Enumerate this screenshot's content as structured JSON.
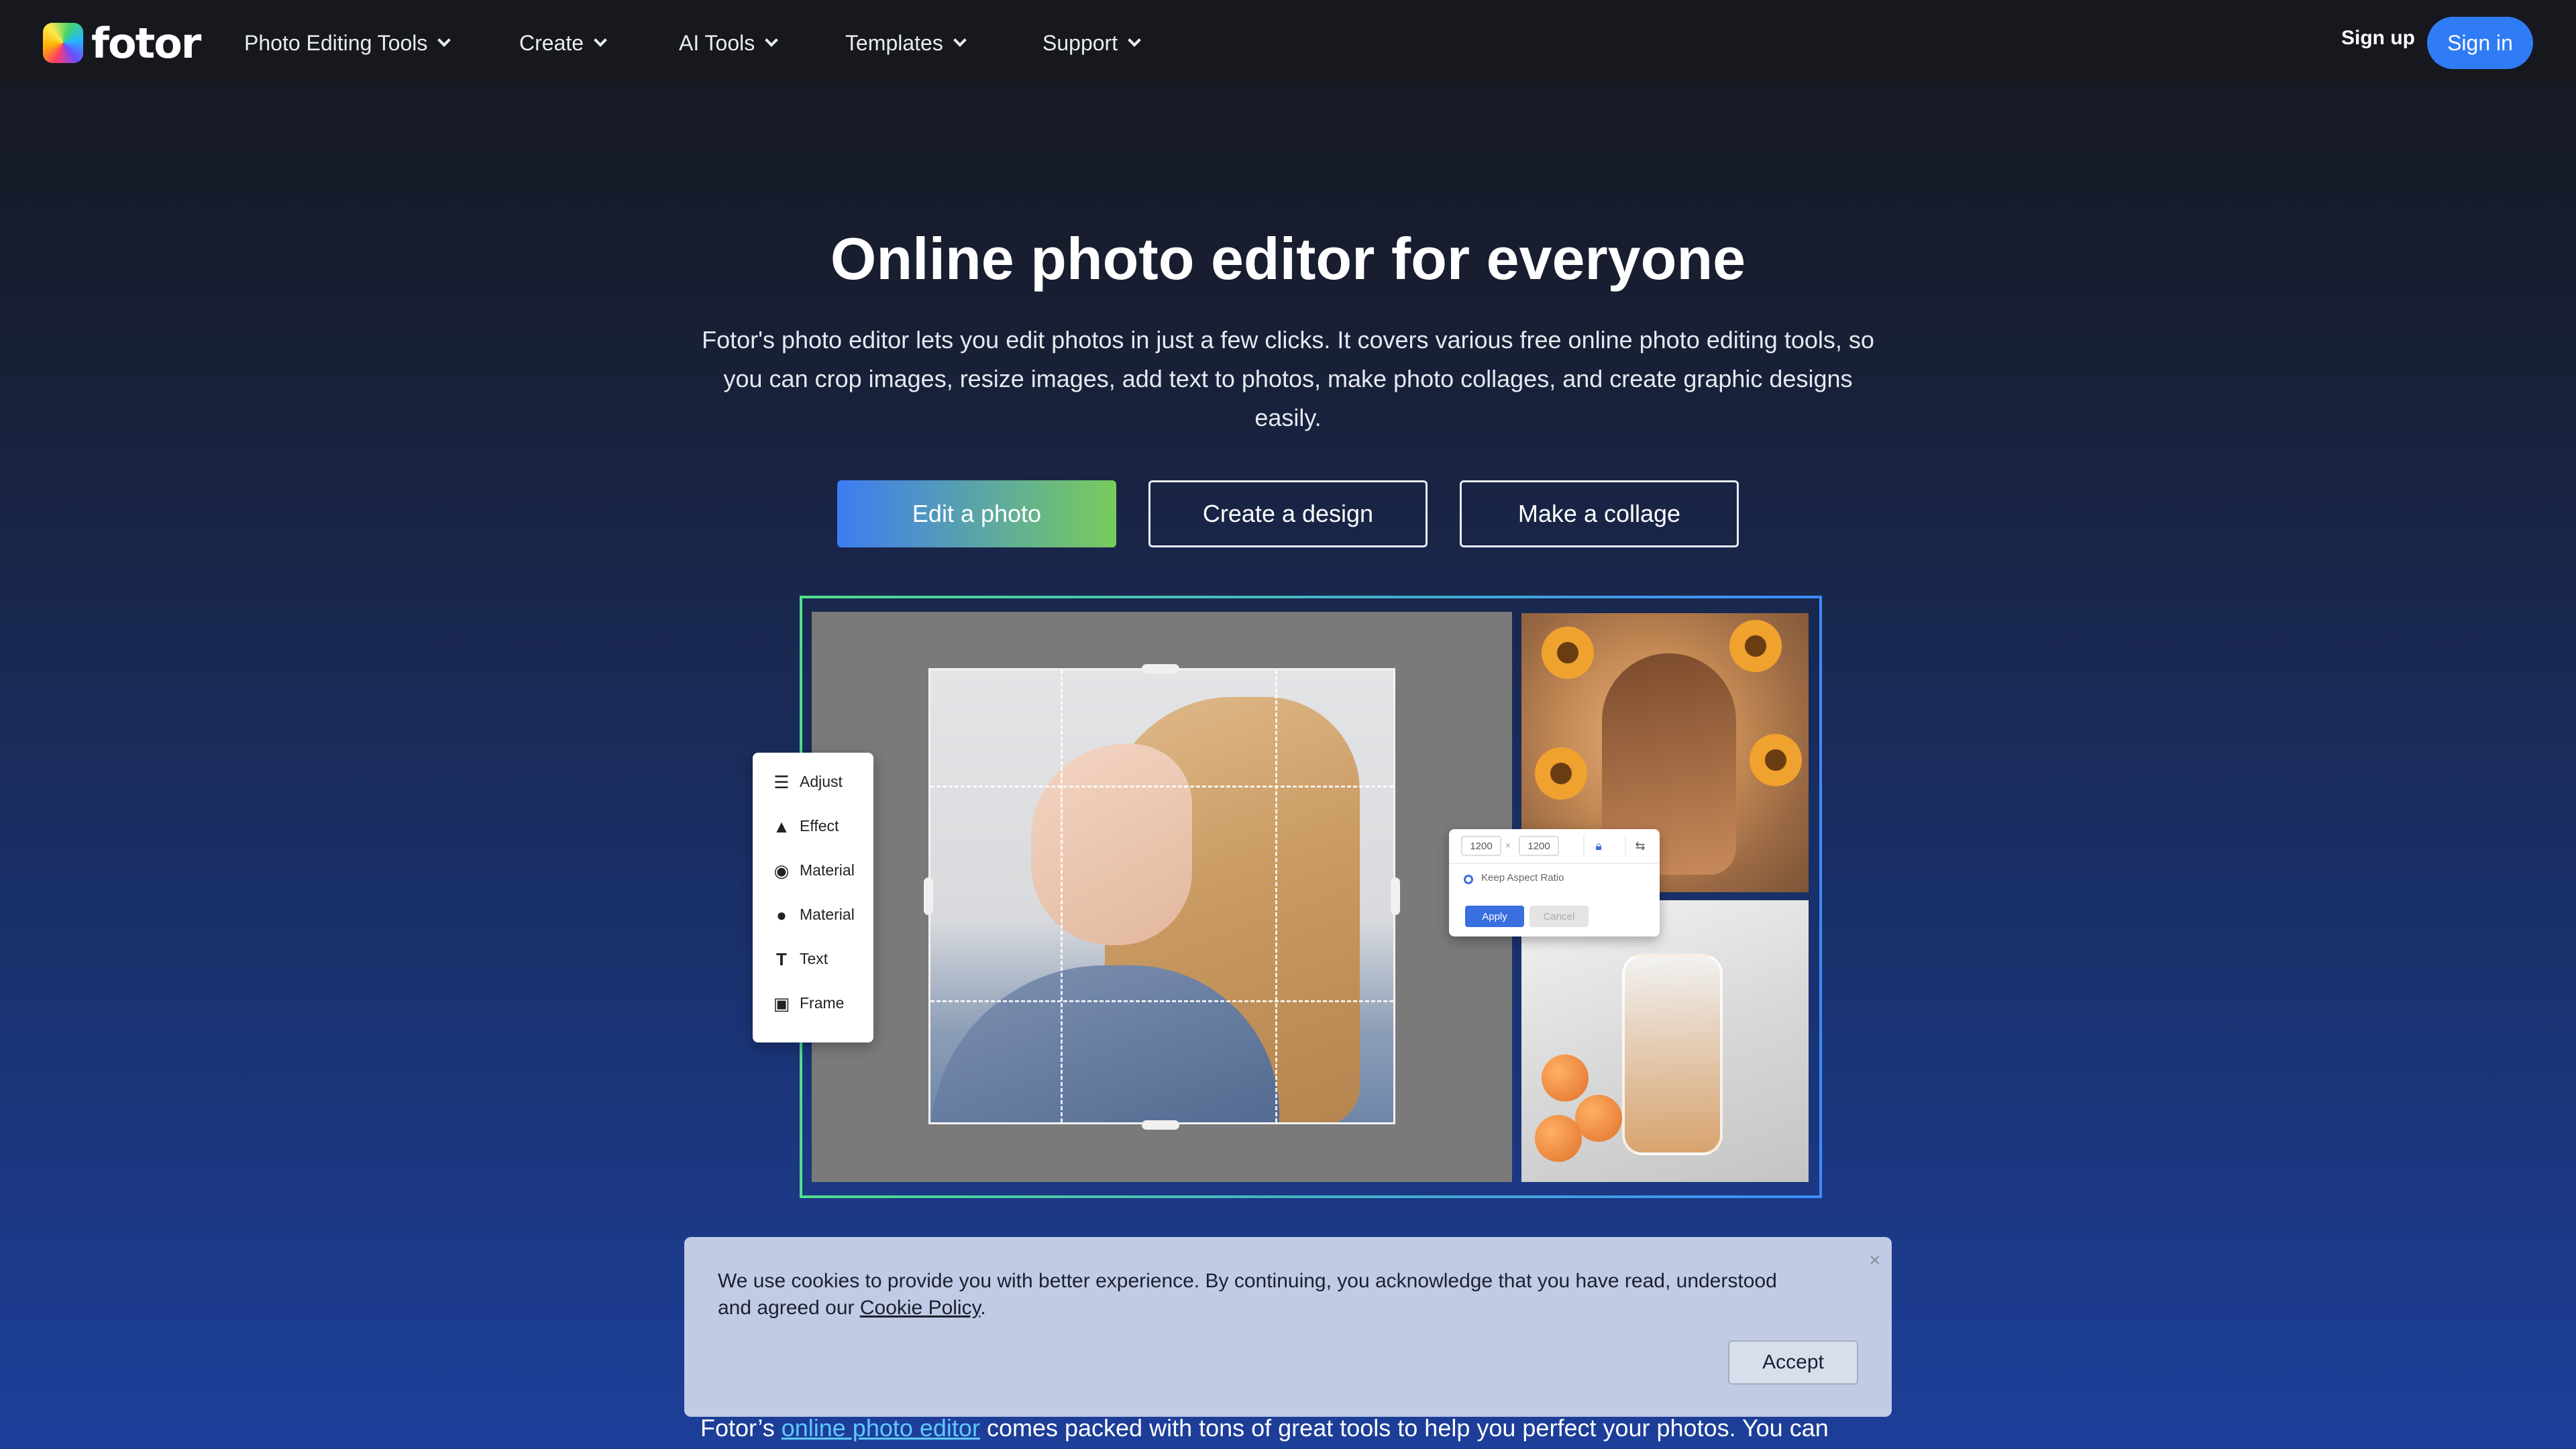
{
  "nav": {
    "logo_text": "fotor",
    "items": [
      {
        "label": "Photo Editing Tools"
      },
      {
        "label": "Create"
      },
      {
        "label": "AI Tools"
      },
      {
        "label": "Templates"
      },
      {
        "label": "Support"
      }
    ],
    "signup_label": "Sign up",
    "signin_label": "Sign in"
  },
  "hero": {
    "title": "Online photo editor for everyone",
    "description": "Fotor's photo editor lets you edit photos in just a few clicks. It covers various free online photo editing tools, so you can crop images, resize images, add text to photos, make photo collages, and create graphic designs easily.",
    "buttons": {
      "edit_photo": "Edit a photo",
      "create_design": "Create a design",
      "make_collage": "Make a collage"
    }
  },
  "showcase": {
    "tools": [
      {
        "label": "Adjust",
        "icon": "sliders-icon"
      },
      {
        "label": "Effect",
        "icon": "flask-icon"
      },
      {
        "label": "Material",
        "icon": "eye-icon"
      },
      {
        "label": "Material",
        "icon": "circle-icon"
      },
      {
        "label": "Text",
        "icon": "text-icon"
      },
      {
        "label": "Frame",
        "icon": "frame-icon"
      }
    ],
    "resize": {
      "width": "1200",
      "separator": "×",
      "height": "1200",
      "keep_aspect": "Keep Aspect Ratio",
      "apply": "Apply",
      "cancel": "Cancel"
    }
  },
  "section": {
    "text_before_link": "Fotor’s ",
    "link_text": "online photo editor",
    "text_after_link": " comes packed with tons of great tools to help you perfect your photos. You can"
  },
  "cookie": {
    "text": "We use cookies to provide you with better experience. By continuing, you acknowledge that you have read, understood and agreed our ",
    "link": "Cookie Policy",
    "period": ".",
    "accept": "Accept",
    "close": "×"
  },
  "colors": {
    "accent": "#2f7cf6",
    "link": "#5fc8ff"
  }
}
